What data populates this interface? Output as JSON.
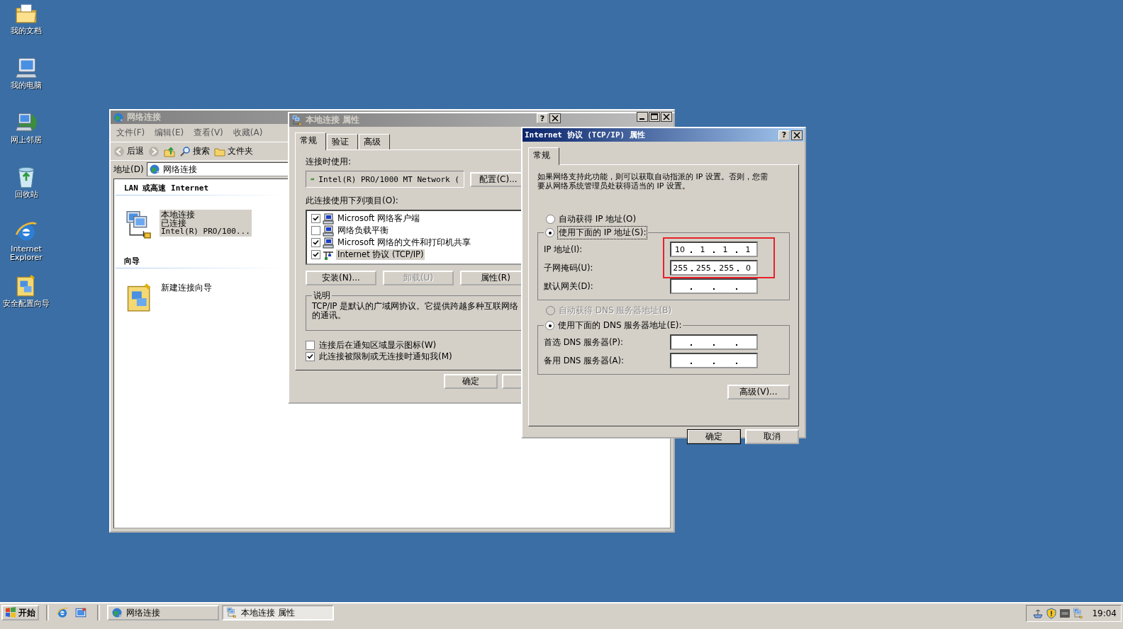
{
  "desktop_icons": [
    {
      "kind": "documents",
      "label": "我的文档"
    },
    {
      "kind": "computer",
      "label": "我的电脑"
    },
    {
      "kind": "network",
      "label": "网上邻居"
    },
    {
      "kind": "recycle",
      "label": "回收站"
    },
    {
      "kind": "browser",
      "label": "Internet Explorer"
    },
    {
      "kind": "wizard",
      "label": "安全配置向导"
    }
  ],
  "network_window": {
    "title": "网络连接",
    "active": false,
    "menu": [
      "文件(F)",
      "编辑(E)",
      "查看(V)",
      "收藏(A)"
    ],
    "toolbar": [
      {
        "kind": "back",
        "label": "后退"
      },
      {
        "kind": "forward"
      },
      {
        "kind": "up"
      },
      {
        "kind": "search",
        "label": "搜索"
      },
      {
        "kind": "folders",
        "label": "文件夹"
      }
    ],
    "address_label": "地址(D)",
    "address": "网络连接",
    "groups": [
      {
        "heading": "LAN 或高速 Internet",
        "items": [
          {
            "kind": "connection",
            "lines": [
              "本地连接",
              "已连接",
              "Intel(R) PRO/100..."
            ],
            "selected": true
          }
        ]
      },
      {
        "heading": "向导",
        "items": [
          {
            "kind": "wizard",
            "lines": [
              "新建连接向导"
            ],
            "selected": false
          }
        ]
      }
    ]
  },
  "properties_dialog": {
    "title": "本地连接 属性",
    "active": false,
    "help": "?",
    "tabs": [
      {
        "label": "常规",
        "selected": true
      },
      {
        "label": "验证",
        "selected": false
      },
      {
        "label": "高级",
        "selected": false
      }
    ],
    "connect_using_label": "连接时使用:",
    "adapter": "Intel(R) PRO/1000 MT Network (",
    "configure_button": "配置(C)...",
    "items_label": "此连接使用下列项目(O):",
    "components": [
      {
        "kind": "client",
        "label": "Microsoft 网络客户端",
        "checked": true,
        "selected": false
      },
      {
        "kind": "client",
        "label": "网络负载平衡",
        "checked": false,
        "selected": false
      },
      {
        "kind": "client",
        "label": "Microsoft 网络的文件和打印机共享",
        "checked": true,
        "selected": false
      },
      {
        "kind": "protocol",
        "label": "Internet 协议 (TCP/IP)",
        "checked": true,
        "selected": true
      }
    ],
    "buttons": [
      {
        "label": "安装(N)...",
        "disabled": false
      },
      {
        "label": "卸载(U)",
        "disabled": true
      },
      {
        "label": "属性(R)",
        "disabled": false
      }
    ],
    "description_title": "说明",
    "description_lines": [
      "TCP/IP 是默认的广域网协议。它提供跨越多种互联网络",
      "的通讯。"
    ],
    "options": [
      {
        "label": "连接后在通知区域显示图标(W)",
        "checked": false
      },
      {
        "label": "此连接被限制或无连接时通知我(M)",
        "checked": true
      }
    ],
    "ok_button": "确定"
  },
  "tcpip_dialog": {
    "title": "Internet 协议 (TCP/IP) 属性",
    "active": true,
    "help": "?",
    "tabs": [
      {
        "label": "常规",
        "selected": true
      }
    ],
    "intro": "如果网络支持此功能，则可以获取自动指派的 IP 设置。否则，您需要从网络系统管理员处获得适当的 IP 设置。",
    "ip_radios": [
      {
        "label": "自动获得 IP 地址(O)",
        "selected": false,
        "disabled": false
      },
      {
        "label": "使用下面的 IP 地址(S):",
        "selected": true,
        "disabled": false
      }
    ],
    "ip_fields": [
      {
        "label": "IP 地址(I):",
        "octets": [
          "10",
          "1",
          "1",
          "1"
        ],
        "highlighted": true
      },
      {
        "label": "子网掩码(U):",
        "octets": [
          "255",
          "255",
          "255",
          "0"
        ],
        "highlighted": true
      },
      {
        "label": "默认网关(D):",
        "highlighted": false
      }
    ],
    "dns_radios": [
      {
        "label": "自动获得 DNS 服务器地址(B)",
        "selected": false,
        "disabled": true
      },
      {
        "label": "使用下面的 DNS 服务器地址(E):",
        "selected": true,
        "disabled": false
      }
    ],
    "dns_fields": [
      {
        "label": "首选 DNS 服务器(P):",
        "highlighted": false
      },
      {
        "label": "备用 DNS 服务器(A):",
        "highlighted": false
      }
    ],
    "advanced_button": "高级(V)...",
    "ok_button": "确定",
    "cancel_button": "取消"
  },
  "taskbar": {
    "start": "开始",
    "quick_launch": [
      {
        "kind": "browser"
      },
      {
        "kind": "desktop"
      }
    ],
    "tasks": [
      {
        "kind": "globe",
        "label": "网络连接",
        "selected": false
      },
      {
        "kind": "connection",
        "label": "本地连接 属性",
        "selected": true
      }
    ],
    "tray": [
      {
        "kind": "network"
      },
      {
        "kind": "shield"
      },
      {
        "kind": "vm"
      },
      {
        "kind": "connection"
      }
    ],
    "clock": "19:04"
  }
}
